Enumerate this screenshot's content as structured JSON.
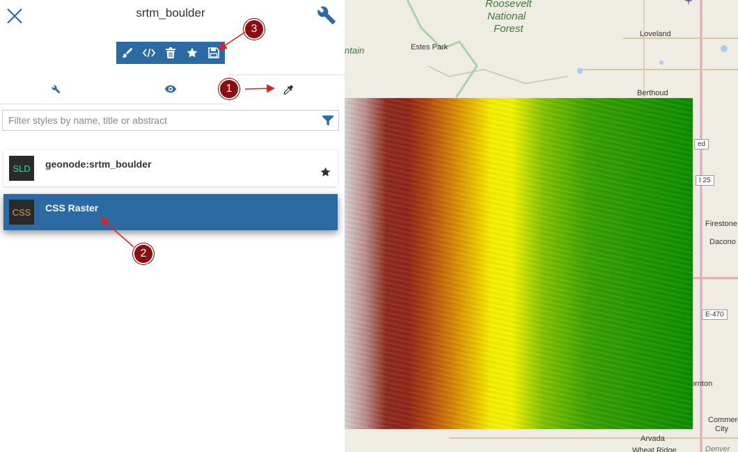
{
  "header": {
    "title": "srtm_boulder"
  },
  "toolbar": {
    "buttons": [
      "edit",
      "code",
      "delete",
      "favorite",
      "save"
    ]
  },
  "tabs": [
    "settings",
    "preview",
    "styles"
  ],
  "filter": {
    "placeholder": "Filter styles by name, title or abstract",
    "value": ""
  },
  "styles": [
    {
      "badge": "SLD",
      "badge_color": "#3dd6a0",
      "name": "geonode:srtm_boulder",
      "default": true,
      "selected": false
    },
    {
      "badge": "CSS",
      "badge_color": "#e8a23a",
      "name": "CSS Raster",
      "default": false,
      "selected": true
    }
  ],
  "map": {
    "labels": {
      "roosevelt": "Roosevelt",
      "national": "National",
      "forest": "Forest",
      "estes_park": "Estes Park",
      "mountain": "ntain",
      "loveland": "Loveland",
      "berthoud": "Berthoud",
      "firestone": "Firestone",
      "dacono": "Dacono",
      "thornton": "ornton",
      "commerce": "Commerc",
      "city": "City",
      "arvada": "Arvada",
      "wheat_ridge": "Wheat Ridge",
      "denver": "Denver"
    },
    "shields": {
      "i25": "I 25",
      "e470": "E-470",
      "partial": "ed"
    }
  },
  "markers": [
    "1",
    "2",
    "3"
  ],
  "colors": {
    "accent": "#2b6aa3",
    "marker": "#8b0d0d"
  }
}
